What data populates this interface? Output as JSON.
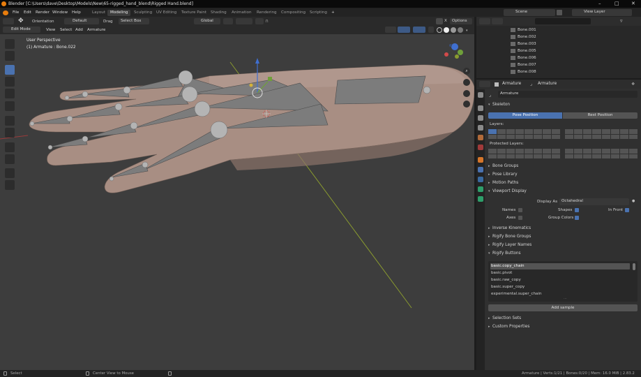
{
  "titlebar": {
    "title": "Blender [C:\\Users\\dave\\Desktop\\Models\\New\\65-rigged_hand_blend\\Rigged Hand.blend]"
  },
  "menu": [
    "File",
    "Edit",
    "Render",
    "Window",
    "Help"
  ],
  "workspaces": [
    "Layout",
    "Modeling",
    "Sculpting",
    "UV Editing",
    "Texture Paint",
    "Shading",
    "Animation",
    "Rendering",
    "Compositing",
    "Scripting"
  ],
  "active_workspace": "Modeling",
  "topright": {
    "scene": "Scene",
    "view_layer": "View Layer"
  },
  "viewport_header": {
    "orientation_label": "Orientation",
    "orientation_value": "Default",
    "drag_label": "Drag",
    "drag_value": "Select Box",
    "transform_orientation": "Global",
    "options": "Options",
    "mode": "Edit Mode",
    "menus": [
      "View",
      "Select",
      "Add",
      "Armature"
    ]
  },
  "viewport_overlay": {
    "perspective": "User Perspective",
    "object": "(1) Armature : Bone.022"
  },
  "outliner": {
    "bones": [
      "Bone.001",
      "Bone.002",
      "Bone.003",
      "Bone.005",
      "Bone.006",
      "Bone.007",
      "Bone.008"
    ]
  },
  "properties": {
    "crumb_object": "Armature",
    "crumb_data": "Armature",
    "data_name": "Armature",
    "skeleton": "Skeleton",
    "pose_position": "Pose Position",
    "rest_position": "Rest Position",
    "layers_label": "Layers:",
    "protected_layers_label": "Protected Layers:",
    "collapsed_sections": [
      "Bone Groups",
      "Pose Library",
      "Motion Paths"
    ],
    "viewport_display": "Viewport Display",
    "display_as_label": "Display As",
    "display_as_value": "Octahedral",
    "names": "Names",
    "axes": "Axes",
    "shapes": "Shapes",
    "group_colors": "Group Colors",
    "in_front": "In Front",
    "rigify_sections": [
      "Inverse Kinematics",
      "Rigify Bone Groups",
      "Rigify Layer Names",
      "Rigify Buttons"
    ],
    "samples": [
      "basic.copy_chain",
      "basic.pivot",
      "basic.raw_copy",
      "basic.super_copy",
      "experimental.super_chain"
    ],
    "add_sample": "Add sample",
    "bottom_sections": [
      "Selection Sets",
      "Custom Properties"
    ]
  },
  "status": {
    "select": "Select",
    "center": "Center View to Mouse",
    "info": "Armature | Verts:1/21 | Bones:0/20 | Mem: 16.0 MiB | 2.83.2"
  },
  "colors": {
    "accent": "#4a72b0",
    "skin": "#a88e83",
    "bone": "#7c7c7c",
    "background": "#3d3d3d"
  }
}
